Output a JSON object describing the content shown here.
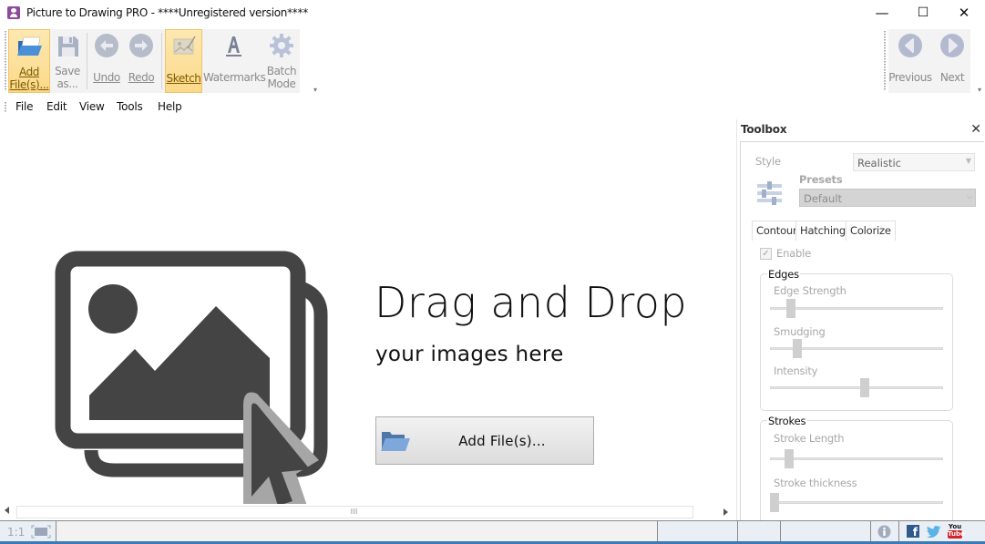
{
  "window": {
    "title": "Picture to Drawing PRO - ****Unregistered version****",
    "minimize": "—",
    "maximize": "☐",
    "close": "✕"
  },
  "toolbar": {
    "add_files_line1": "Add",
    "add_files_line2": "File(s)...",
    "save_line1": "Save",
    "save_line2": "as...",
    "undo": "Undo",
    "redo": "Redo",
    "sketch": "Sketch",
    "watermarks": "Watermarks",
    "batch_line1": "Batch",
    "batch_line2": "Mode",
    "previous": "Previous",
    "next": "Next",
    "overflow": "▾"
  },
  "menu": {
    "items": [
      "File",
      "Edit",
      "View",
      "Tools",
      "Help"
    ]
  },
  "dropzone": {
    "title": "Drag and Drop",
    "subtitle": "your images here",
    "button_label": "Add File(s)..."
  },
  "toolbox": {
    "header": "Toolbox",
    "close": "✕",
    "style_label": "Style",
    "style_value": "Realistic",
    "presets_label": "Presets",
    "presets_value": "Default",
    "tabs": [
      "Contour",
      "Hatching",
      "Colorize"
    ],
    "active_tab": "Contour",
    "enable_label": "Enable",
    "enable_checked": true,
    "edges": {
      "title": "Edges",
      "sliders": [
        {
          "label": "Edge Strength",
          "value_fraction": 0.1
        },
        {
          "label": "Smudging",
          "value_fraction": 0.14
        },
        {
          "label": "Intensity",
          "value_fraction": 0.55
        }
      ]
    },
    "strokes": {
      "title": "Strokes",
      "sliders": [
        {
          "label": "Stroke Length",
          "value_fraction": 0.09
        },
        {
          "label": "Stroke thickness",
          "value_fraction": 0.0
        }
      ]
    }
  },
  "statusbar": {
    "zoom_label": "1:1",
    "icons": [
      "info-icon",
      "facebook-icon",
      "twitter-icon",
      "youtube-icon"
    ],
    "youtube_top": "You",
    "youtube_bottom": "Tube",
    "facebook": "f"
  },
  "colors": {
    "active_tool_bg": "#fbd98a",
    "accent_blue": "#3c7ab5",
    "icon_gray": "#444444"
  }
}
